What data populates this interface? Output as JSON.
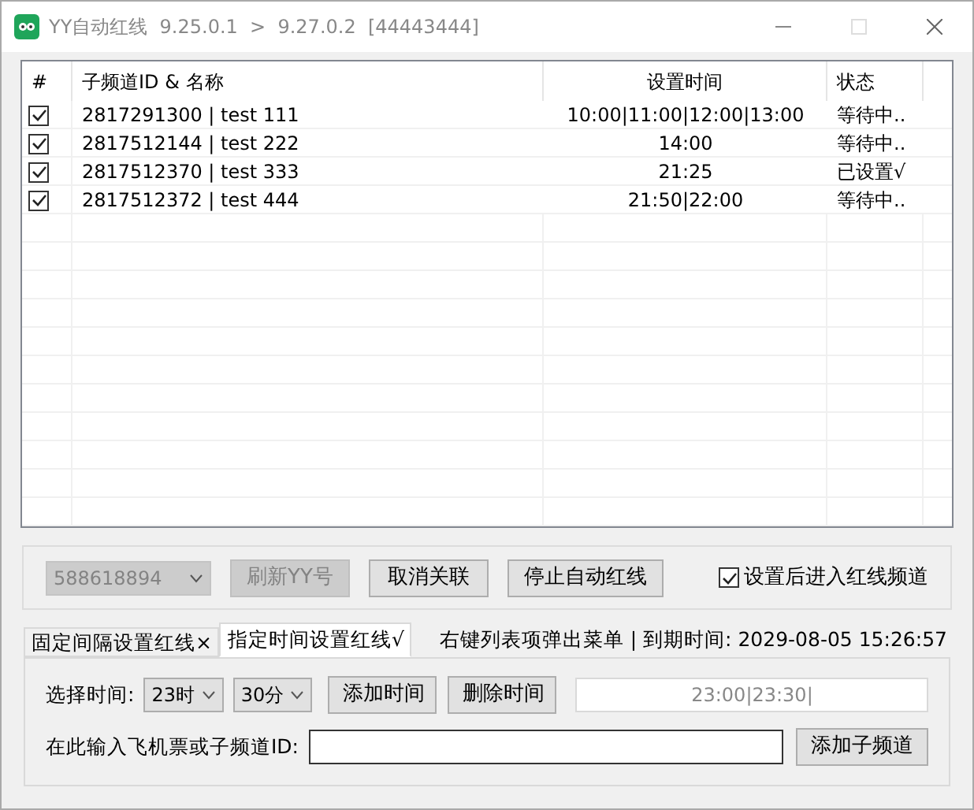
{
  "window": {
    "title": "YY自动红线  9.25.0.1  >  9.27.0.2  [44443444]"
  },
  "table": {
    "columns": [
      "#",
      "子频道ID & 名称",
      "设置时间",
      "状态"
    ],
    "rows": [
      {
        "checked": true,
        "name": "2817291300 | test 111",
        "times": "10:00|11:00|12:00|13:00",
        "status": "等待中.."
      },
      {
        "checked": true,
        "name": "2817512144 | test 222",
        "times": "14:00",
        "status": "等待中.."
      },
      {
        "checked": true,
        "name": "2817512370 | test 333",
        "times": "21:25",
        "status": "已设置√"
      },
      {
        "checked": true,
        "name": "2817512372 | test 444",
        "times": "21:50|22:00",
        "status": "等待中.."
      }
    ]
  },
  "controls": {
    "account": {
      "value": "588618894",
      "disabled": true
    },
    "buttons": [
      {
        "label": "刷新YY号",
        "disabled": true
      },
      {
        "label": "取消关联",
        "disabled": false
      },
      {
        "label": "停止自动红线",
        "disabled": false
      }
    ],
    "enter_channel": {
      "label": "设置后进入红线频道",
      "checked": true
    }
  },
  "tabs": [
    {
      "label": "固定间隔设置红线×",
      "selected": false
    },
    {
      "label": "指定时间设置红线√",
      "selected": true
    }
  ],
  "info": "右键列表项弹出菜单 | 到期时间: 2029-08-05 15:26:57",
  "panel": {
    "time_label": "选择时间:",
    "hour": "23时",
    "minute": "30分",
    "add_time": "添加时间",
    "delete_time": "删除时间",
    "times": "23:00|23:30|",
    "id_label": "在此输入飞机票或子频道ID:",
    "add_channel": "添加子频道"
  }
}
